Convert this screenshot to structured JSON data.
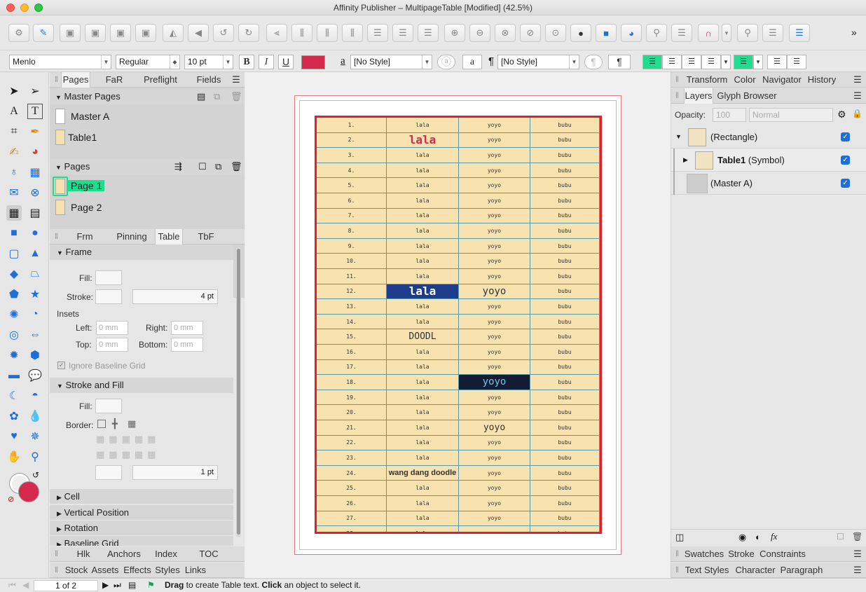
{
  "window": {
    "title": "Affinity Publisher – MultipageTable [Modified] (42.5%)"
  },
  "context_bar": {
    "font": "Menlo",
    "style": "Regular",
    "size": "10 pt",
    "bold": "B",
    "italic": "I",
    "underline": "U",
    "text_color": "#d42a4e",
    "char_style_icon": "a",
    "char_style": "[No Style]",
    "char_a": "a",
    "para_mark": "¶",
    "para_style": "[No Style]",
    "para_btn": "¶"
  },
  "left_panel": {
    "tabs": [
      "Pages",
      "FaR",
      "Preflight",
      "Fields"
    ],
    "master_pages_header": "Master Pages",
    "master_pages": [
      "Master A",
      "Table1"
    ],
    "pages_header": "Pages",
    "pages": [
      "Page 1",
      "Page 2"
    ],
    "tabs2": [
      "Frm",
      "Pinning",
      "Table",
      "TbF"
    ],
    "frame_header": "Frame",
    "fill_label": "Fill:",
    "stroke_label": "Stroke:",
    "stroke_value": "4 pt",
    "insets_label": "Insets",
    "left_label": "Left:",
    "left_value": "0 mm",
    "right_label": "Right:",
    "right_value": "0 mm",
    "top_label": "Top:",
    "top_value": "0 mm",
    "bottom_label": "Bottom:",
    "bottom_value": "0 mm",
    "ignore_baseline": "Ignore Baseline Grid",
    "stroke_fill_header": "Stroke and Fill",
    "fill2_label": "Fill:",
    "border_label": "Border:",
    "border_weight": "1 pt",
    "collapsed_sections": [
      "Cell",
      "Vertical Position",
      "Rotation",
      "Baseline Grid"
    ],
    "bottom_tabs1": [
      "Hlk",
      "Anchors",
      "Index",
      "TOC"
    ],
    "bottom_tabs2": [
      "Stock",
      "Assets",
      "Effects",
      "Styles",
      "Links"
    ]
  },
  "table": {
    "rows": [
      [
        "1.",
        "lala",
        "yoyo",
        "bubu"
      ],
      [
        "2.",
        "lala",
        "yoyo",
        "bubu"
      ],
      [
        "3.",
        "lala",
        "yoyo",
        "bubu"
      ],
      [
        "4.",
        "lala",
        "yoyo",
        "bubu"
      ],
      [
        "5.",
        "lala",
        "yoyo",
        "bubu"
      ],
      [
        "6.",
        "lala",
        "yoyo",
        "bubu"
      ],
      [
        "7.",
        "lala",
        "yoyo",
        "bubu"
      ],
      [
        "8.",
        "lala",
        "yoyo",
        "bubu"
      ],
      [
        "9.",
        "lala",
        "yoyo",
        "bubu"
      ],
      [
        "10.",
        "lala",
        "yoyo",
        "bubu"
      ],
      [
        "11.",
        "lala",
        "yoyo",
        "bubu"
      ],
      [
        "12.",
        "lala",
        "yoyo",
        "bubu"
      ],
      [
        "13.",
        "lala",
        "yoyo",
        "bubu"
      ],
      [
        "14.",
        "lala",
        "yoyo",
        "bubu"
      ],
      [
        "15.",
        "DOODL",
        "yoyo",
        "bubu"
      ],
      [
        "16.",
        "lala",
        "yoyo",
        "bubu"
      ],
      [
        "17.",
        "lala",
        "yoyo",
        "bubu"
      ],
      [
        "18.",
        "lala",
        "yoyo",
        "bubu"
      ],
      [
        "19.",
        "lala",
        "yoyo",
        "bubu"
      ],
      [
        "20.",
        "lala",
        "yoyo",
        "bubu"
      ],
      [
        "21.",
        "lala",
        "yoyo",
        "bubu"
      ],
      [
        "22.",
        "lala",
        "yoyo",
        "bubu"
      ],
      [
        "23.",
        "lala",
        "yoyo",
        "bubu"
      ],
      [
        "24.",
        "wang dang doodle",
        "yoyo",
        "bubu"
      ],
      [
        "25.",
        "lala",
        "yoyo",
        "bubu"
      ],
      [
        "26.",
        "lala",
        "yoyo",
        "bubu"
      ],
      [
        "27.",
        "lala",
        "yoyo",
        "bubu"
      ],
      [
        "28.",
        "lala",
        "yoyo",
        "bubu"
      ]
    ]
  },
  "right_panel": {
    "tabs1": [
      "Transform",
      "Color",
      "Navigator",
      "History"
    ],
    "tabs2": [
      "Layers",
      "Glyph Browser"
    ],
    "opacity_label": "Opacity:",
    "opacity_value": "100",
    "blend_mode": "Normal",
    "layers": [
      {
        "name": "(Rectangle)",
        "bold": ""
      },
      {
        "name": " (Symbol)",
        "bold": "Table1"
      },
      {
        "name": "(Master A)",
        "bold": ""
      }
    ],
    "bottom_tabs1": [
      "Swatches",
      "Stroke",
      "Constraints"
    ],
    "bottom_tabs2": [
      "Text Styles",
      "Character",
      "Paragraph"
    ]
  },
  "status": {
    "page_indicator": "1 of 2",
    "hint_bold1": "Drag",
    "hint_text1": " to create Table text. ",
    "hint_bold2": "Click",
    "hint_text2": " an object to select it."
  }
}
